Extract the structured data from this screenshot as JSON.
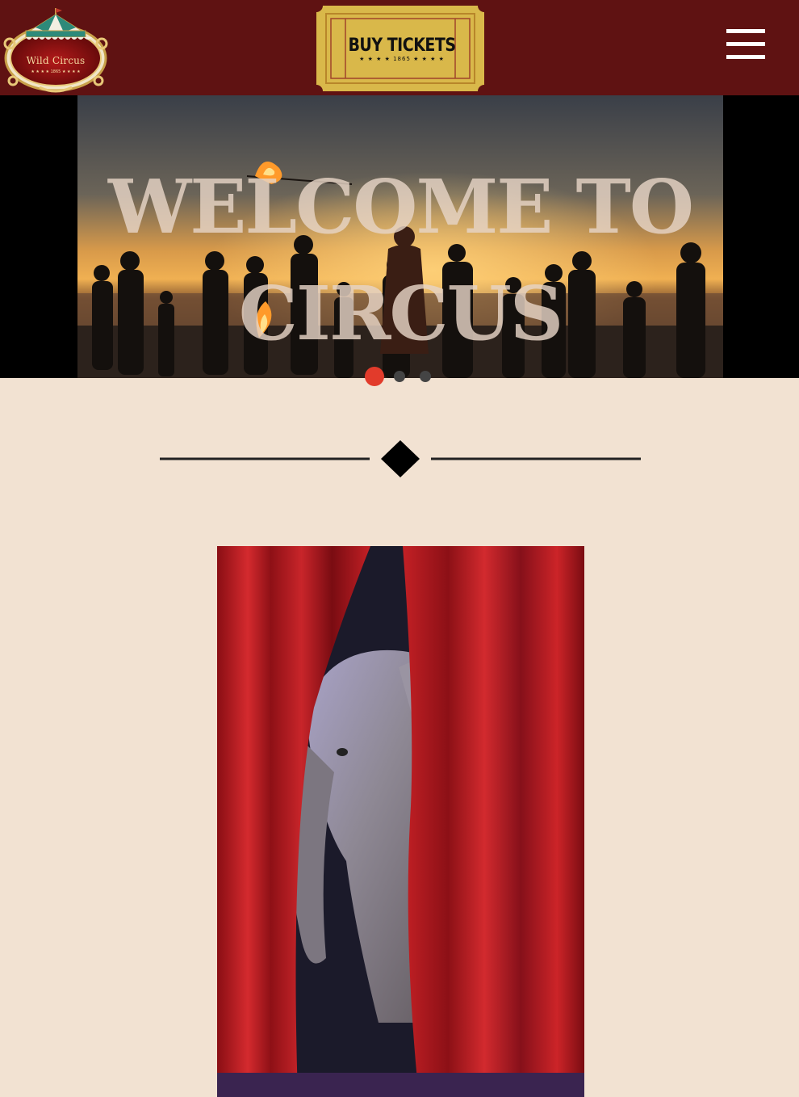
{
  "header": {
    "logo": {
      "text": "Wild Circus",
      "year": "★ ★ ★ ★  1865  ★ ★ ★ ★",
      "icon": "circus-tent-logo-icon"
    },
    "buy_tickets": {
      "label": "BUY TICKETS",
      "sub": "★ ★ ★ ★   1865   ★ ★ ★ ★"
    },
    "menu_icon": "hamburger-menu-icon"
  },
  "hero": {
    "title": "WELCOME TO CIRCUS",
    "slides": 3,
    "active_slide": 1,
    "image": "fire-performer-beach-sunset"
  },
  "divider_icon": "diamond-divider-icon",
  "feature": {
    "image": "elephant-stage-curtains"
  },
  "colors": {
    "header_bg": "#5f1212",
    "page_bg": "#f2e2d2",
    "dot_active": "#e23b2b",
    "dot_inactive": "#444444",
    "ticket_gold": "#d9b84a"
  }
}
